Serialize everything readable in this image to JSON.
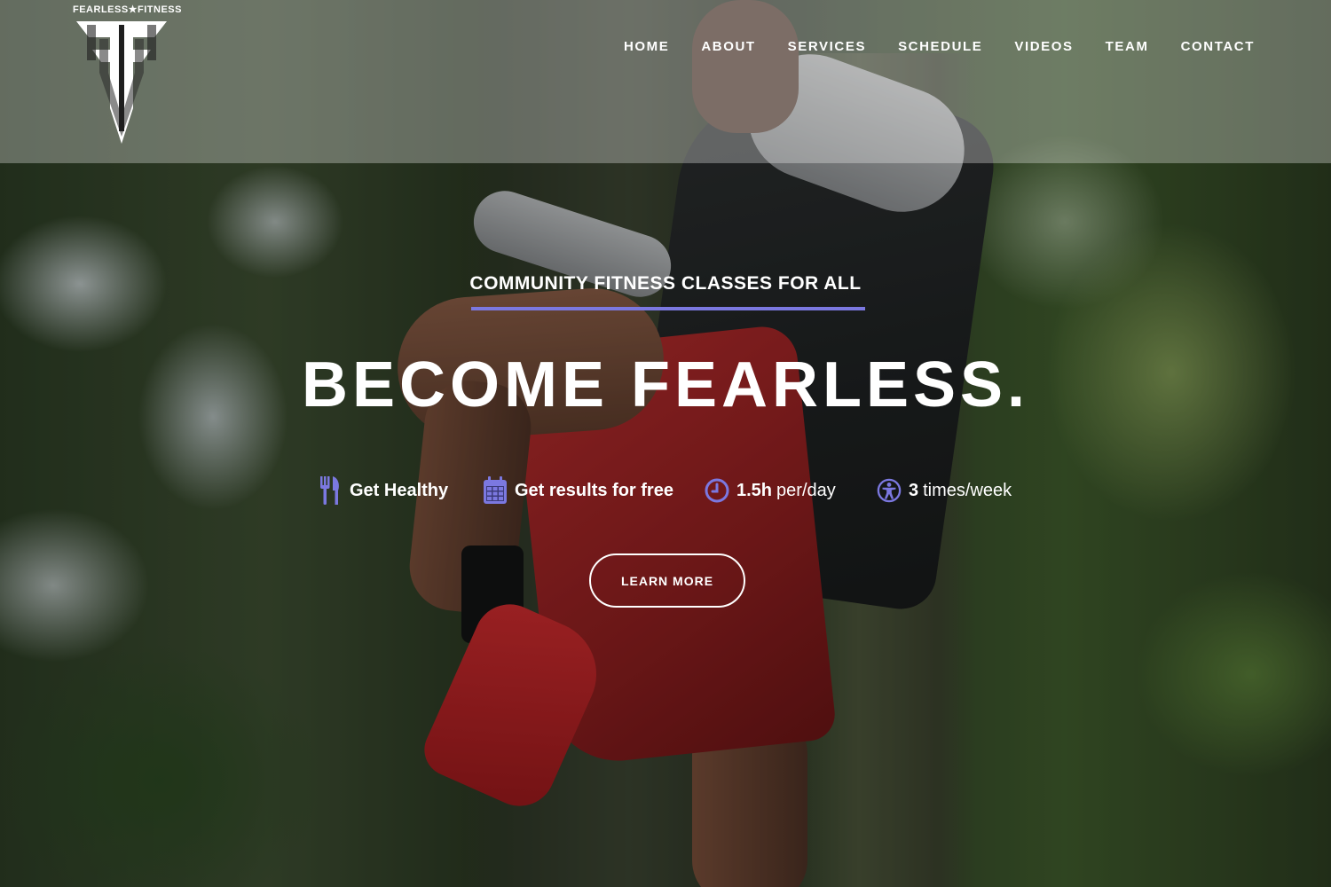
{
  "brand": {
    "logo_text": "FEARLESS★FITNESS",
    "logo_monogram": "FF"
  },
  "nav": {
    "items": [
      {
        "label": "HOME"
      },
      {
        "label": "ABOUT"
      },
      {
        "label": "SERVICES"
      },
      {
        "label": "SCHEDULE"
      },
      {
        "label": "VIDEOS"
      },
      {
        "label": "TEAM"
      },
      {
        "label": "CONTACT"
      }
    ]
  },
  "hero": {
    "eyebrow": "COMMUNITY FITNESS CLASSES FOR ALL",
    "headline": "BECOME FEARLESS.",
    "features": [
      {
        "icon": "fork-knife-icon",
        "strong": "Get Healthy",
        "rest": ""
      },
      {
        "icon": "calendar-icon",
        "strong": "Get results for free",
        "rest": ""
      },
      {
        "icon": "clock-icon",
        "strong": "1.5h",
        "rest": "per/day"
      },
      {
        "icon": "accessibility-icon",
        "strong": "3",
        "rest": "times/week"
      }
    ],
    "cta_label": "LEARN MORE"
  },
  "colors": {
    "accent": "#7b78e0",
    "text": "#ffffff",
    "nav_band": "rgba(255,255,255,0.30)"
  }
}
